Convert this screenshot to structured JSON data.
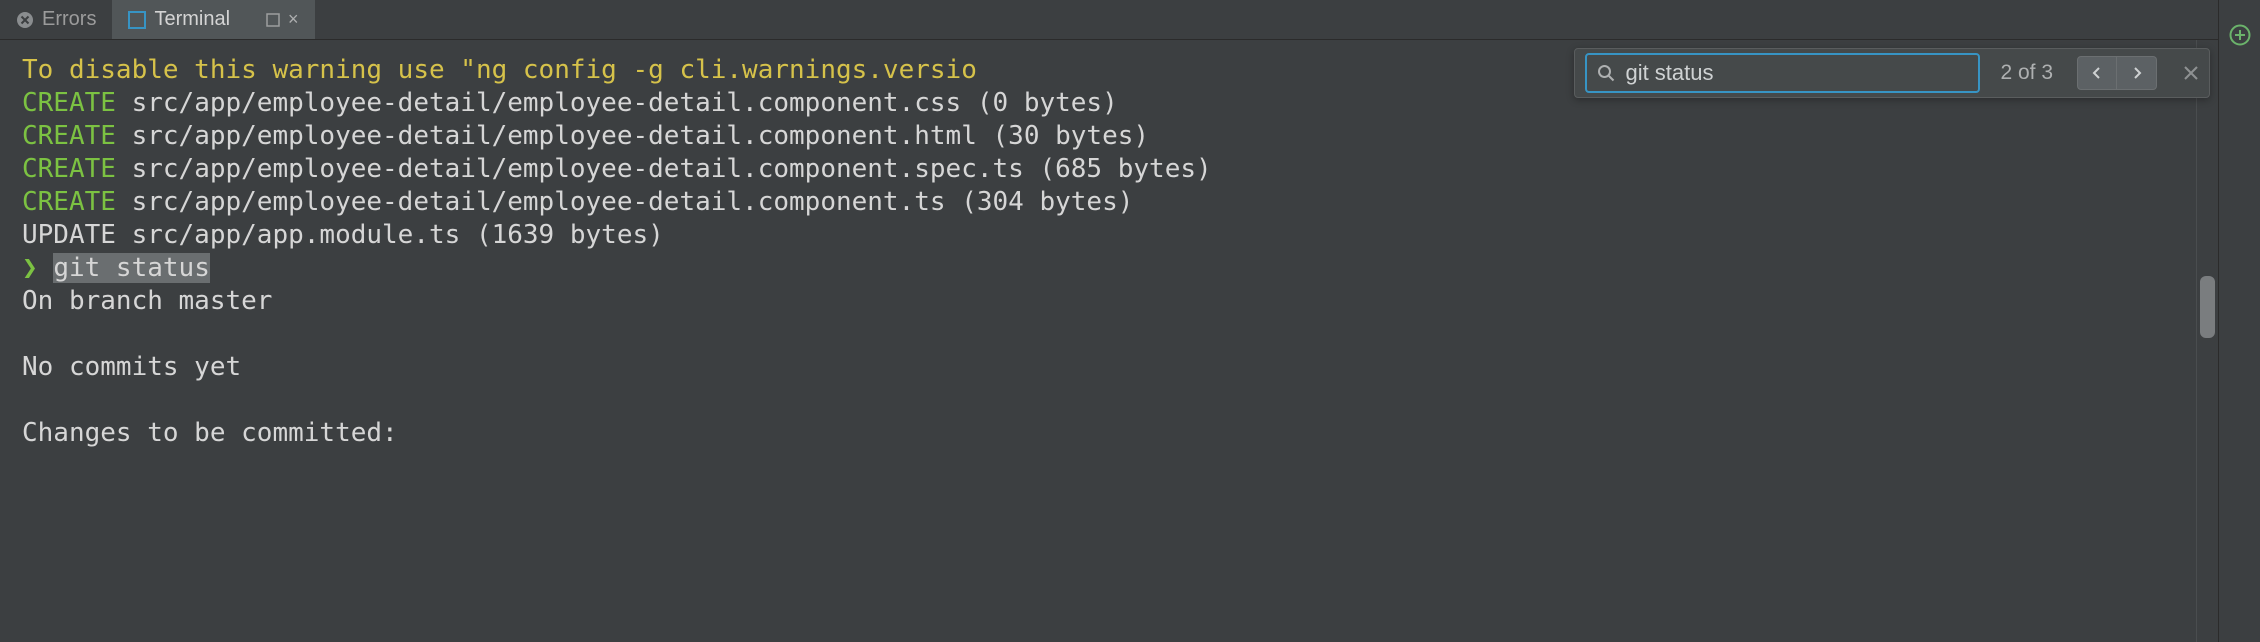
{
  "tabs": {
    "errors": {
      "label": "Errors"
    },
    "terminal": {
      "label": "Terminal"
    }
  },
  "find": {
    "value": "git status",
    "count_text": "2 of 3"
  },
  "terminal": {
    "lines": [
      {
        "cls": "yellow",
        "text": "To disable this warning use \"ng config -g cli.warnings.versio"
      },
      {
        "create": true,
        "path": "src/app/employee-detail/employee-detail.component.css (0 bytes)"
      },
      {
        "create": true,
        "path": "src/app/employee-detail/employee-detail.component.html (30 bytes)"
      },
      {
        "create": true,
        "path": "src/app/employee-detail/employee-detail.component.spec.ts (685 bytes)"
      },
      {
        "create": true,
        "path": "src/app/employee-detail/employee-detail.component.ts (304 bytes)"
      },
      {
        "plain": true,
        "text": "UPDATE src/app/app.module.ts (1639 bytes)"
      },
      {
        "prompt": true,
        "cmd": "git status"
      },
      {
        "plain": true,
        "text": "On branch master"
      },
      {
        "blank": true
      },
      {
        "plain": true,
        "text": "No commits yet"
      },
      {
        "blank": true
      },
      {
        "plain": true,
        "text": "Changes to be committed:"
      }
    ],
    "create_label": "CREATE",
    "prompt_char": "❯"
  }
}
